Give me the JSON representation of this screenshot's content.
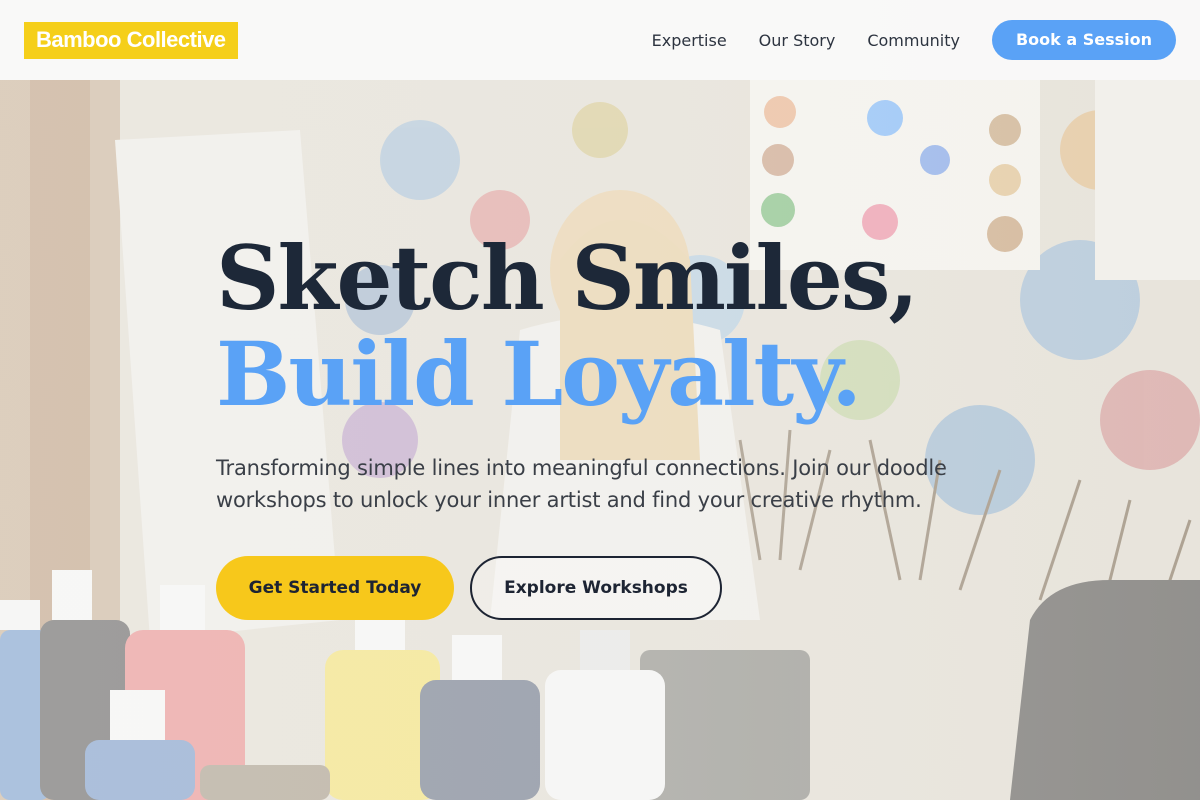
{
  "header": {
    "logo_text": "Bamboo Collective",
    "nav": [
      {
        "label": "Expertise"
      },
      {
        "label": "Our Story"
      },
      {
        "label": "Community"
      }
    ],
    "cta_label": "Book a Session"
  },
  "hero": {
    "headline_line1": "Sketch Smiles,",
    "headline_line2": "Build Loyalty.",
    "lede": "Transforming simple lines into meaningful connections. Join our doodle workshops to unlock your inner artist and find your creative rhythm.",
    "primary_cta": "Get Started Today",
    "secondary_cta": "Explore Workshops",
    "background_image": "children-painting-in-art-studio"
  },
  "colors": {
    "accent_yellow": "#f7c81b",
    "accent_blue": "#5aa2f6",
    "heading_dark": "#1d2838"
  }
}
